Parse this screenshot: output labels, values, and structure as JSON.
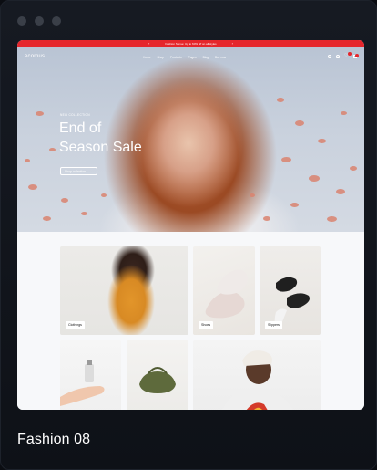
{
  "window": {
    "dots": [
      "dot-1",
      "dot-2",
      "dot-3"
    ]
  },
  "site": {
    "logo": "ecomus",
    "announcement": "Fashion Sense: Up to 60% off on all styles",
    "menu": [
      "Home",
      "Shop",
      "Products",
      "Pages",
      "Blog",
      "Buy now"
    ],
    "icons": [
      "search-icon",
      "user-icon",
      "heart-icon",
      "bag-icon"
    ]
  },
  "hero": {
    "eyebrow": "NEW COLLECTION",
    "headline_line1": "End of",
    "headline_line2": "Season Sale",
    "cta": "Shop collection"
  },
  "categories": [
    {
      "label": "Clothings"
    },
    {
      "label": "Shoes"
    },
    {
      "label": "Slippers"
    }
  ],
  "caption": "Fashion 08",
  "colors": {
    "accent": "#e5262c",
    "background": "#0b0d12"
  }
}
